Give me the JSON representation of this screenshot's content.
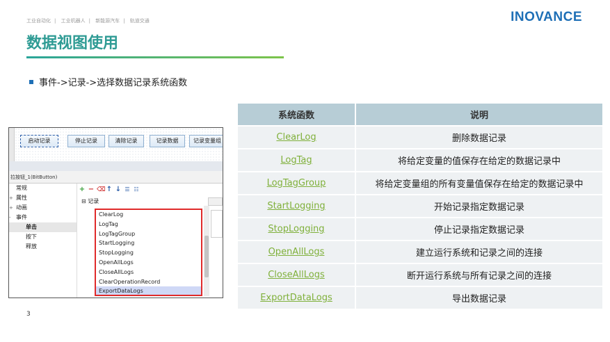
{
  "header": {
    "breadcrumb": [
      "工业自动化",
      "工业机器人",
      "新能源汽车",
      "轨道交通"
    ],
    "logo": "INOVANCE",
    "title": "数据视图使用",
    "bullet": "事件->记录->选择数据记录系统函数"
  },
  "page_number": "3",
  "screenshot": {
    "buttons": [
      "启动记录",
      "停止记录",
      "清除记录",
      "记录数据",
      "记录变量组"
    ],
    "prop_title": "拉按钮_1(BitButton)",
    "tree": [
      {
        "label": "常规",
        "expander": ""
      },
      {
        "label": "属性",
        "expander": "+"
      },
      {
        "label": "动画",
        "expander": "+"
      },
      {
        "label": "事件",
        "expander": "-"
      },
      {
        "label": "单击",
        "expander": ""
      },
      {
        "label": "按下",
        "expander": ""
      },
      {
        "label": "释放",
        "expander": ""
      }
    ],
    "record_node": "记录",
    "functions": [
      "ClearLog",
      "LogTag",
      "LogTagGroup",
      "StartLogging",
      "StopLogging",
      "OpenAllLogs",
      "CloseAllLogs",
      "ClearOperationRecord",
      "ExportDataLogs"
    ],
    "toolbar_icons": [
      "plus-icon",
      "minus-icon",
      "delete-icon",
      "arrow-up-icon",
      "arrow-down-icon",
      "list-icon",
      "list-alt-icon"
    ]
  },
  "table": {
    "headers": [
      "系统函数",
      "说明"
    ],
    "rows": [
      {
        "fn": "ClearLog",
        "desc": "删除数据记录"
      },
      {
        "fn": "LogTag",
        "desc": "将给定变量的值保存在给定的数据记录中"
      },
      {
        "fn": "LogTagGroup",
        "desc": "将给定变量组的所有变量值保存在给定的数据记录中"
      },
      {
        "fn": "StartLogging",
        "desc": "开始记录指定数据记录"
      },
      {
        "fn": "StopLogging",
        "desc": "停止记录指定数据记录"
      },
      {
        "fn": "OpenAllLogs",
        "desc": "建立运行系统和记录之间的连接"
      },
      {
        "fn": "CloseAllLogs",
        "desc": "断开运行系统与所有记录之间的连接"
      },
      {
        "fn": "ExportDataLogs",
        "desc": "导出数据记录"
      }
    ]
  },
  "colors": {
    "title": "#2e9b94",
    "logo": "#1e6fb6",
    "link": "#7fb03a",
    "header_bg": "#b7cdd6",
    "highlight_box": "#e02a2a"
  }
}
